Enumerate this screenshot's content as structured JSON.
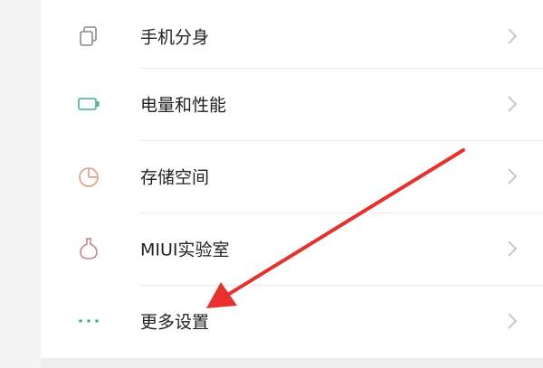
{
  "settings": {
    "items": [
      {
        "label": "手机分身",
        "icon": "dual-apps-icon",
        "icon_color": "#8a8a8a"
      },
      {
        "label": "电量和性能",
        "icon": "battery-icon",
        "icon_color": "#3bb29a"
      },
      {
        "label": "存储空间",
        "icon": "pie-chart-icon",
        "icon_color": "#e79a74"
      },
      {
        "label": "MIUI实验室",
        "icon": "flask-icon",
        "icon_color": "#c68a8a"
      },
      {
        "label": "更多设置",
        "icon": "more-dots-icon",
        "icon_color": "#3bb29a"
      }
    ]
  },
  "annotation": {
    "arrow_color": "#e8312c"
  },
  "colors": {
    "background": "#f4f4f4",
    "card": "#ffffff",
    "separator": "#ececec",
    "chevron": "#c4c4c4",
    "text": "#222222"
  }
}
